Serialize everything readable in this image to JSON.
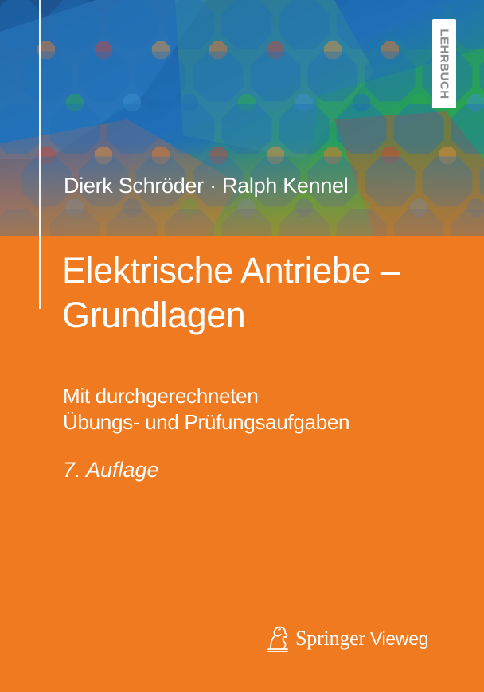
{
  "cover": {
    "series_badge": "LEHRBUCH",
    "authors": "Dierk Schröder · Ralph Kennel",
    "title_lines": [
      "Elektrische Antriebe –",
      "Grundlagen"
    ],
    "subtitle_lines": [
      "Mit durchgerechneten",
      "Übungs- und Prüfungsaufgaben"
    ],
    "edition": "7. Auflage",
    "publisher": {
      "name": "Springer",
      "imprint": "Vieweg",
      "logo_icon": "springer-knight-icon"
    },
    "colors": {
      "background": "#ef7a1f",
      "text": "#ffffff",
      "pattern_blue": "#1f6fb8",
      "pattern_green": "#2aa84a",
      "pattern_orange": "#e8782a",
      "pattern_red": "#c4463a"
    }
  }
}
